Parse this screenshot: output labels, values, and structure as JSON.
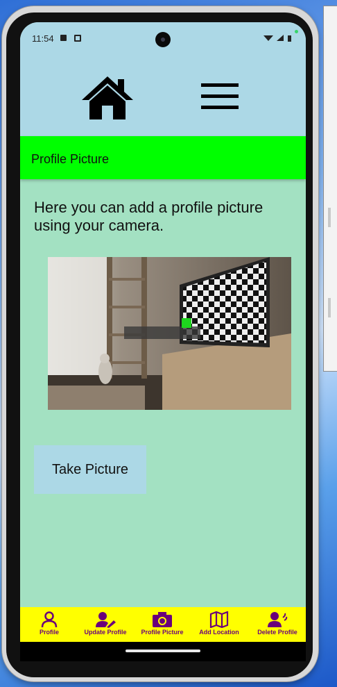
{
  "status_bar": {
    "time": "11:54"
  },
  "header": {
    "home_icon": "home-icon",
    "menu_icon": "hamburger-menu-icon"
  },
  "title_bar": {
    "title": "Profile Picture"
  },
  "content": {
    "intro_text": "Here you can add a profile picture using your camera.",
    "camera_preview": "camera-preview-image",
    "take_picture_label": "Take Picture"
  },
  "bottom_nav": {
    "items": [
      {
        "label": "Profile",
        "icon": "person-icon"
      },
      {
        "label": "Update Profile",
        "icon": "person-edit-icon"
      },
      {
        "label": "Profile Picture",
        "icon": "camera-icon"
      },
      {
        "label": "Add Location",
        "icon": "map-icon"
      },
      {
        "label": "Delete Profile",
        "icon": "person-remove-icon"
      }
    ]
  },
  "colors": {
    "header_bg": "#acd8e6",
    "title_bar_bg": "#00ff00",
    "content_bg": "#a3e1c2",
    "button_bg": "#acd8e6",
    "bottom_nav_bg": "#ffff00",
    "nav_accent": "#6a007a"
  }
}
